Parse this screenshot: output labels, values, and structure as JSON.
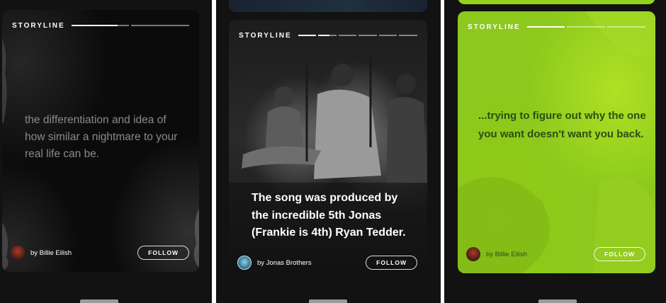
{
  "colors": {
    "app_background": "#121212",
    "green_card": "#8cc91c",
    "green_card_text": "#2c4d12",
    "quote_grey": "#8a8a8a"
  },
  "cards": [
    {
      "storyline_label": "STORYLINE",
      "progress": [
        0.8,
        0
      ],
      "quote": "the differentiation and idea of how similar a nightmare to your real life can be.",
      "byline": "by Billie Eilish",
      "avatar_icon": "artist-avatar-icon",
      "follow_label": "FOLLOW"
    },
    {
      "storyline_label": "STORYLINE",
      "progress": [
        1,
        0.6,
        0,
        0,
        0,
        0
      ],
      "quote": "The song was produced by the incredible 5th Jonas (Frankie is 4th) Ryan Tedder.",
      "byline": "by Jonas Brothers",
      "avatar_icon": "artist-avatar-icon",
      "follow_label": "FOLLOW"
    },
    {
      "storyline_label": "STORYLINE",
      "progress": [
        1,
        0,
        0
      ],
      "quote": "...trying to figure out why the one you want doesn't want you back.",
      "byline": "by Billie Eilish",
      "avatar_icon": "artist-avatar-icon",
      "follow_label": "FOLLOW"
    }
  ]
}
